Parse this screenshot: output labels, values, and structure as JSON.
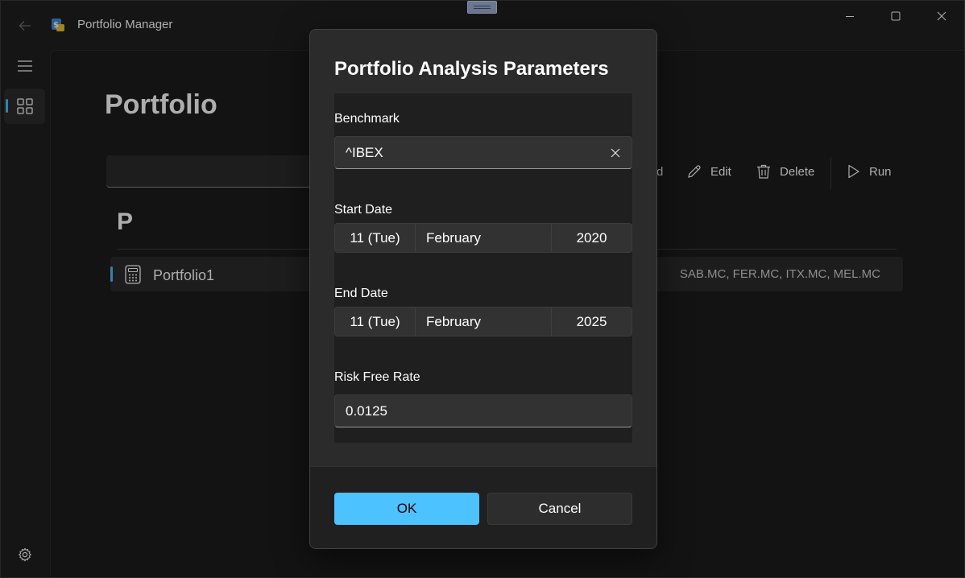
{
  "app": {
    "title": "Portfolio Manager",
    "icon": "app-logo-icon"
  },
  "window_controls": [
    "minimize-icon",
    "maximize-icon",
    "close-icon"
  ],
  "nav": {
    "items": [
      "hamburger-menu-icon",
      "grid-icon"
    ],
    "settings_icon": "gear-icon"
  },
  "page": {
    "title": "Portfolio",
    "command_bar": {
      "add_label_partial": "d",
      "edit_label": "Edit",
      "delete_label": "Delete",
      "run_label": "Run"
    },
    "group_header": "P",
    "portfolio_rows": [
      {
        "name": "Portfolio1",
        "tickers": "SAB.MC, FER.MC, ITX.MC, MEL.MC",
        "icon": "calculator-icon"
      }
    ]
  },
  "dialog": {
    "title": "Portfolio Analysis Parameters",
    "benchmark": {
      "label": "Benchmark",
      "value": "^IBEX"
    },
    "start_date": {
      "label": "Start Date",
      "day": "11 (Tue)",
      "month": "February",
      "year": "2020"
    },
    "end_date": {
      "label": "End Date",
      "day": "11 (Tue)",
      "month": "February",
      "year": "2025"
    },
    "risk_free_rate": {
      "label": "Risk Free Rate",
      "value": "0.0125"
    },
    "ok_label": "OK",
    "cancel_label": "Cancel"
  },
  "colors": {
    "accent": "#4cc2ff",
    "background": "#202020",
    "dialog": "#2b2b2b"
  }
}
